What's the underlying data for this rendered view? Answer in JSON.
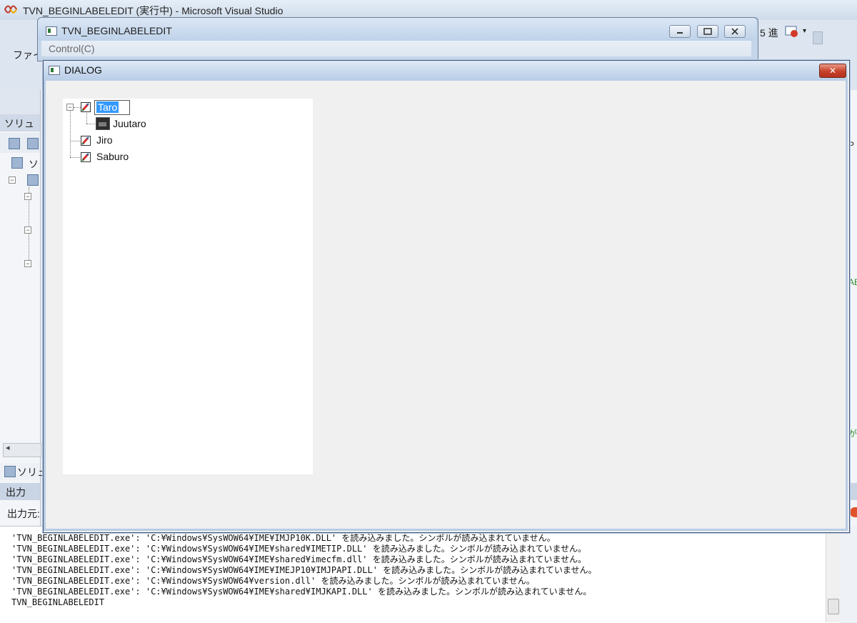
{
  "vs": {
    "title": "TVN_BEGINLABELEDIT (実行中) - Microsoft Visual Studio",
    "menu_file": "ファイ",
    "toolbar_label": "5 進",
    "left_panel": {
      "solution_header": "ソリュ",
      "tree_text": "ソ",
      "bottom_tab": "ソリュ"
    },
    "output": {
      "title": "出力",
      "source_label": "出力元:",
      "lines": [
        "'TVN_BEGINLABELEDIT.exe': 'C:¥Windows¥SysWOW64¥IME¥IMJP10K.DLL' を読み込みました。シンボルが読み込まれていません。",
        "'TVN_BEGINLABELEDIT.exe': 'C:¥Windows¥SysWOW64¥IME¥shared¥IMETIP.DLL' を読み込みました。シンボルが読み込まれていません。",
        "'TVN_BEGINLABELEDIT.exe': 'C:¥Windows¥SysWOW64¥IME¥shared¥imecfm.dll' を読み込みました。シンボルが読み込まれていません。",
        "'TVN_BEGINLABELEDIT.exe': 'C:¥Windows¥SysWOW64¥IME¥IMEJP10¥IMJPAPI.DLL' を読み込みました。シンボルが読み込まれていません。",
        "'TVN_BEGINLABELEDIT.exe': 'C:¥Windows¥SysWOW64¥version.dll' を読み込みました。シンボルが読み込まれていません。",
        "'TVN_BEGINLABELEDIT.exe': 'C:¥Windows¥SysWOW64¥IME¥shared¥IMJKAPI.DLL' を読み込みました。シンボルが読み込まれていません。",
        "TVN_BEGINLABELEDIT"
      ]
    },
    "right_panel": {
      "text1": "P",
      "text2": "AE",
      "text3": "が"
    }
  },
  "app": {
    "title": "TVN_BEGINLABELEDIT",
    "menu_control": "Control(C)"
  },
  "dialog": {
    "title": "DIALOG",
    "close_glyph": "✕",
    "tree": {
      "nodes": [
        {
          "label": "Taro",
          "editing": true,
          "expanded": true,
          "children": [
            {
              "label": "Juutaro"
            }
          ]
        },
        {
          "label": "Jiro"
        },
        {
          "label": "Saburo"
        }
      ]
    }
  }
}
